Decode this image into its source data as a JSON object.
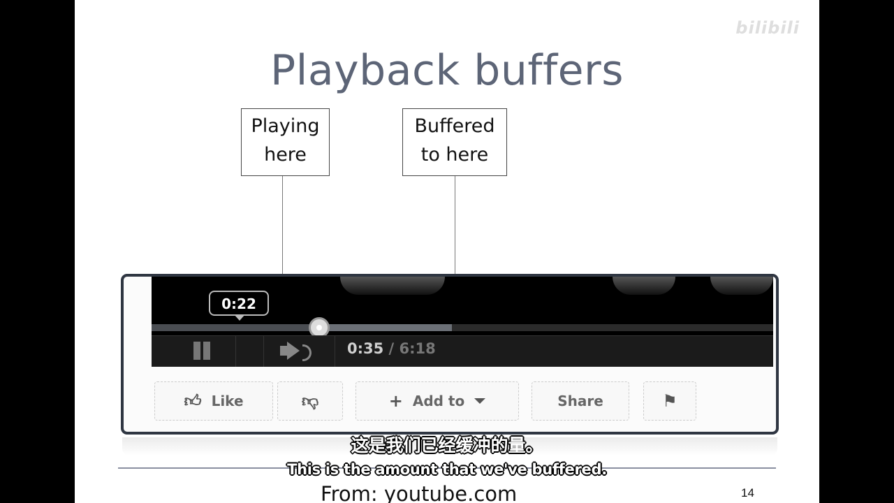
{
  "slide": {
    "title": "Playback buffers",
    "callout_playing": [
      "Playing",
      "here"
    ],
    "callout_buffered": [
      "Buffered",
      "to here"
    ],
    "source": "From: youtube.com",
    "page_number": "14",
    "watermark": "bilibili"
  },
  "player": {
    "hover_time": "0:22",
    "current_time": "0:35",
    "separator": " / ",
    "total_time": "6:18",
    "played_fraction": 0.27,
    "buffered_fraction": 0.483,
    "buttons": {
      "like": "Like",
      "add_to": "Add to",
      "share": "Share"
    }
  },
  "subtitles": {
    "zh": "这是我们已经缓冲的量。",
    "en": "This is the amount that we've buffered."
  }
}
